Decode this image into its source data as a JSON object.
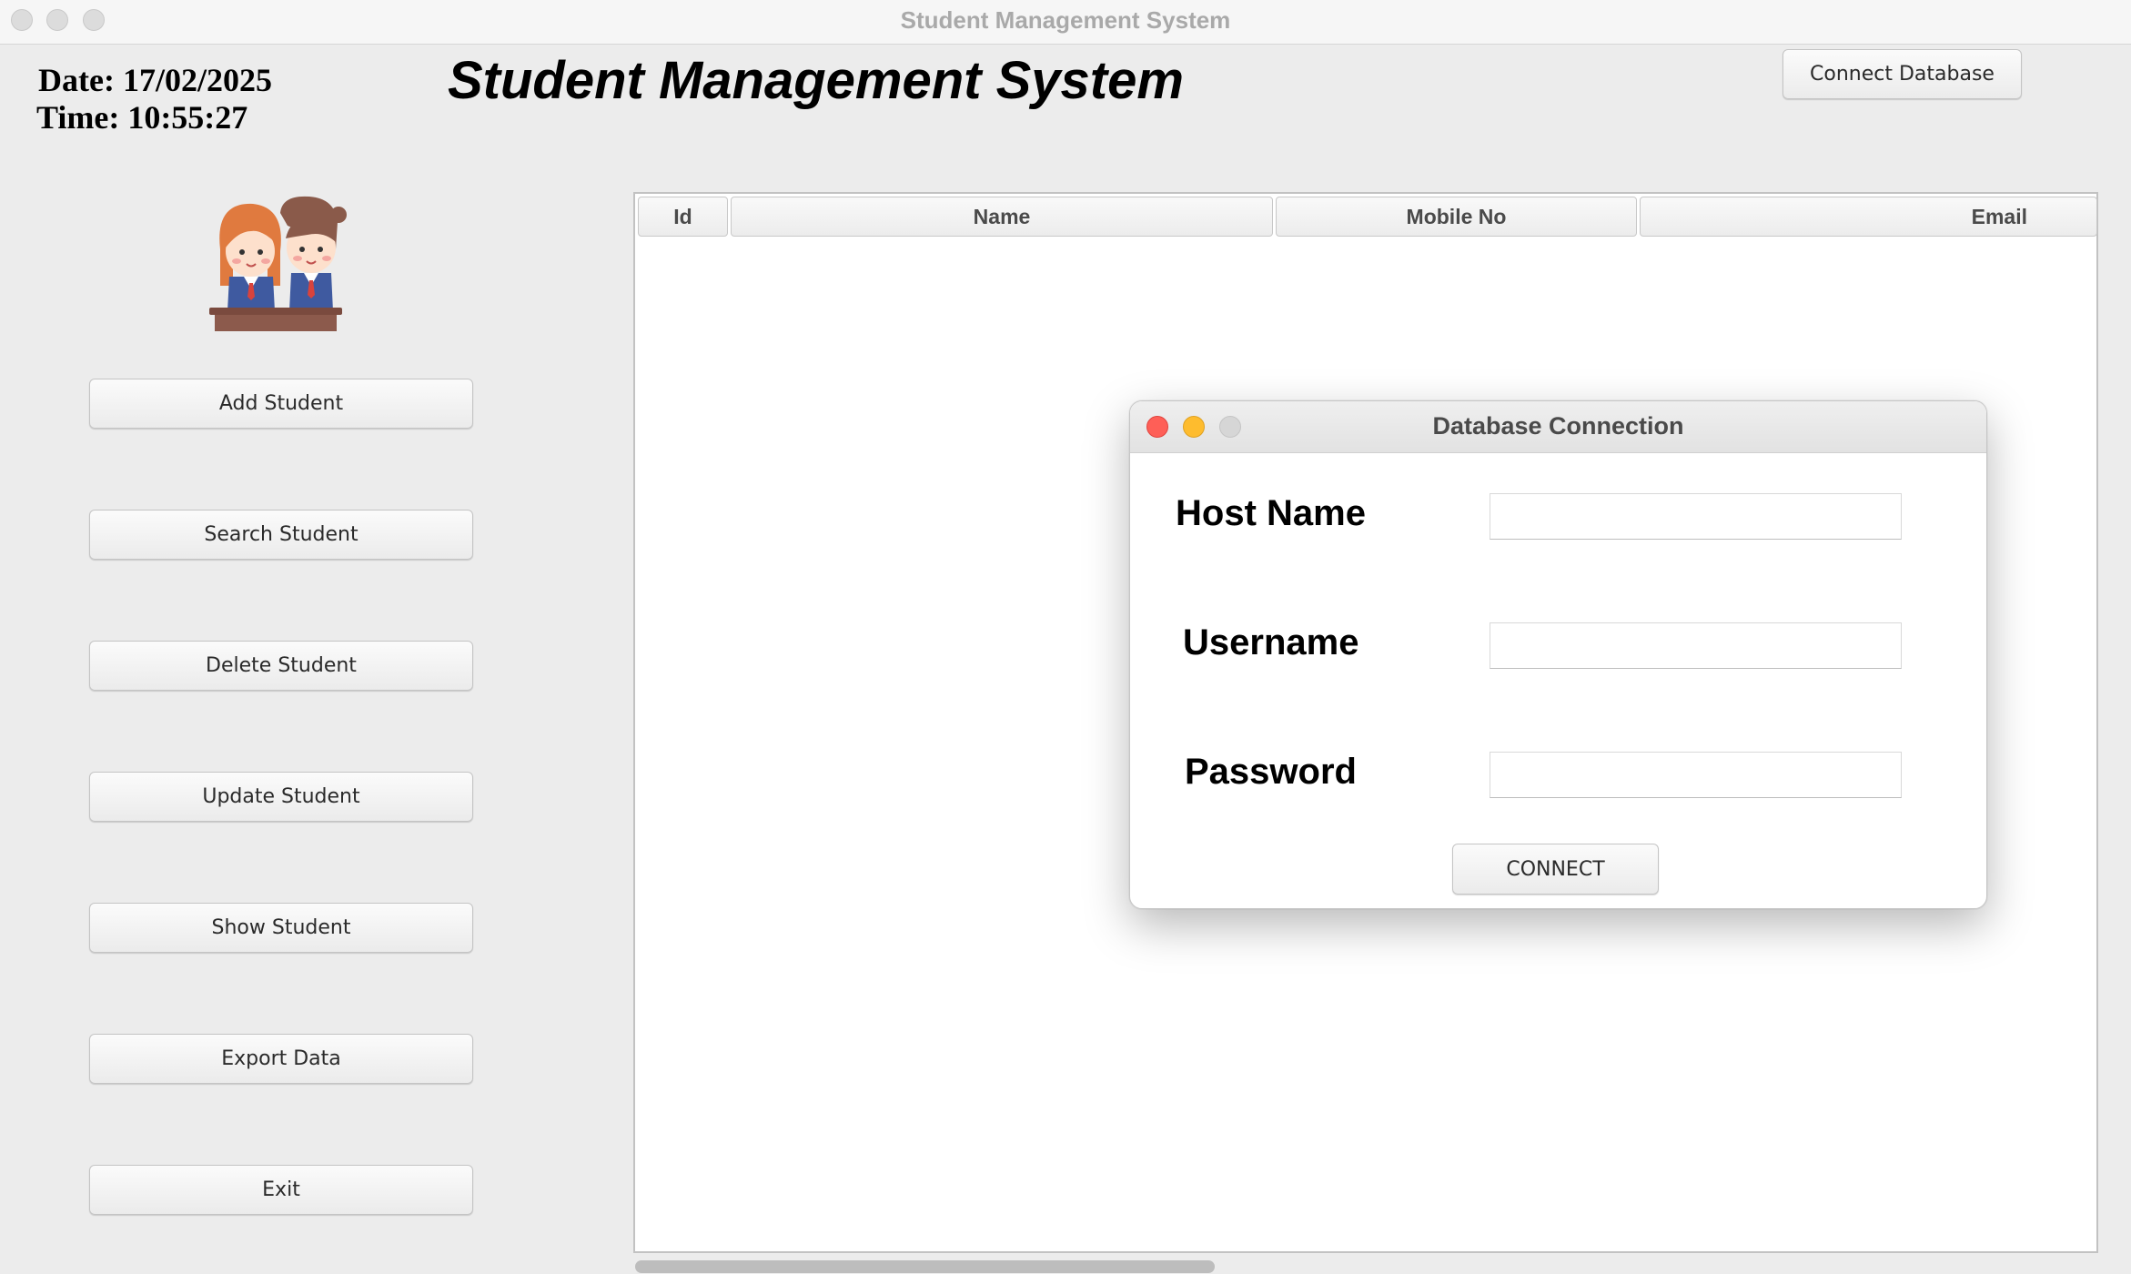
{
  "window": {
    "title": "Student Management System"
  },
  "header": {
    "date_text": "Date: 17/02/2025",
    "time_text": "Time: 10:55:27",
    "app_title": "Student Management System",
    "connect_database_label": "Connect Database"
  },
  "sidebar": {
    "logo_icon": "students-avatar-icon",
    "buttons": [
      {
        "label": "Add Student"
      },
      {
        "label": "Search Student"
      },
      {
        "label": "Delete Student"
      },
      {
        "label": "Update Student"
      },
      {
        "label": "Show Student"
      },
      {
        "label": "Export Data"
      },
      {
        "label": "Exit"
      }
    ]
  },
  "table": {
    "columns": [
      "Id",
      "Name",
      "Mobile No",
      "Email"
    ],
    "rows": []
  },
  "dialog": {
    "title": "Database Connection",
    "host_label": "Host Name",
    "username_label": "Username",
    "password_label": "Password",
    "host_value": "",
    "username_value": "",
    "password_value": "",
    "connect_label": "CONNECT"
  },
  "colors": {
    "close": "#fe5f57",
    "minimize": "#febc2e",
    "window_bg": "#ececec"
  }
}
